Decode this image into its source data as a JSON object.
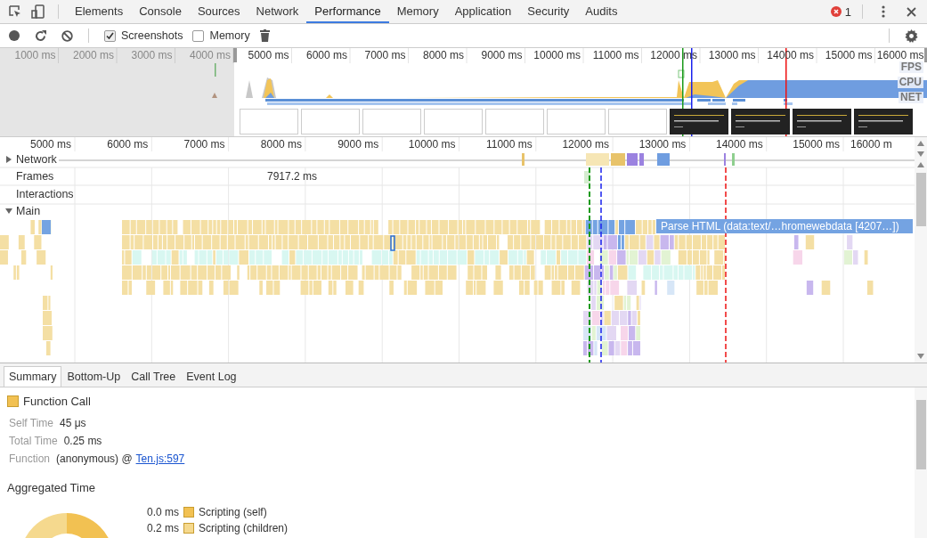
{
  "panel_tabs": [
    {
      "label": "Elements",
      "selected": false
    },
    {
      "label": "Console",
      "selected": false
    },
    {
      "label": "Sources",
      "selected": false
    },
    {
      "label": "Network",
      "selected": false
    },
    {
      "label": "Performance",
      "selected": true
    },
    {
      "label": "Memory",
      "selected": false
    },
    {
      "label": "Application",
      "selected": false
    },
    {
      "label": "Security",
      "selected": false
    },
    {
      "label": "Audits",
      "selected": false
    }
  ],
  "error_count": "1",
  "checkboxes": [
    {
      "label": "Screenshots",
      "checked": true
    },
    {
      "label": "Memory",
      "checked": false
    }
  ],
  "overview": {
    "ticks": [
      "1000 ms",
      "2000 ms",
      "3000 ms",
      "4000 ms",
      "5000 ms",
      "6000 ms",
      "7000 ms",
      "8000 ms",
      "9000 ms",
      "10000 ms",
      "11000 ms",
      "12000 ms",
      "13000 ms",
      "14000 ms",
      "15000 ms",
      "16000 ms"
    ],
    "track_labels": [
      "FPS",
      "CPU",
      "NET"
    ]
  },
  "timeline": {
    "ticks": [
      "5000 ms",
      "6000 ms",
      "7000 ms",
      "8000 ms",
      "9000 ms",
      "10000 ms",
      "11000 ms",
      "12000 ms",
      "13000 ms",
      "14000 ms",
      "15000 ms",
      "16000 m"
    ]
  },
  "tracks": [
    {
      "label": "Network",
      "kind": "group",
      "expanded": false
    },
    {
      "label": "Frames",
      "kind": "row",
      "note": "7917.2 ms"
    },
    {
      "label": "Interactions",
      "kind": "row"
    },
    {
      "label": "Main",
      "kind": "group",
      "expanded": true
    }
  ],
  "flame_label": "Parse HTML (data:text/…hromewebdata [4207…])",
  "details_tabs": [
    {
      "label": "Summary",
      "selected": true
    },
    {
      "label": "Bottom-Up",
      "selected": false
    },
    {
      "label": "Call Tree",
      "selected": false
    },
    {
      "label": "Event Log",
      "selected": false
    }
  ],
  "summary": {
    "title": "Function Call",
    "rows": [
      {
        "label": "Self Time",
        "value": "45 μs"
      },
      {
        "label": "Total Time",
        "value": "0.25 ms"
      },
      {
        "label": "Function",
        "value": "(anonymous) @",
        "link": "Ten.js:597"
      }
    ]
  },
  "aggregated": {
    "title": "Aggregated Time",
    "legend": [
      {
        "value": "0.0 ms",
        "label": "Scripting (self)",
        "color": "#f2c152"
      },
      {
        "value": "0.2 ms",
        "label": "Scripting (children)",
        "color": "#f5d98e"
      }
    ]
  }
}
